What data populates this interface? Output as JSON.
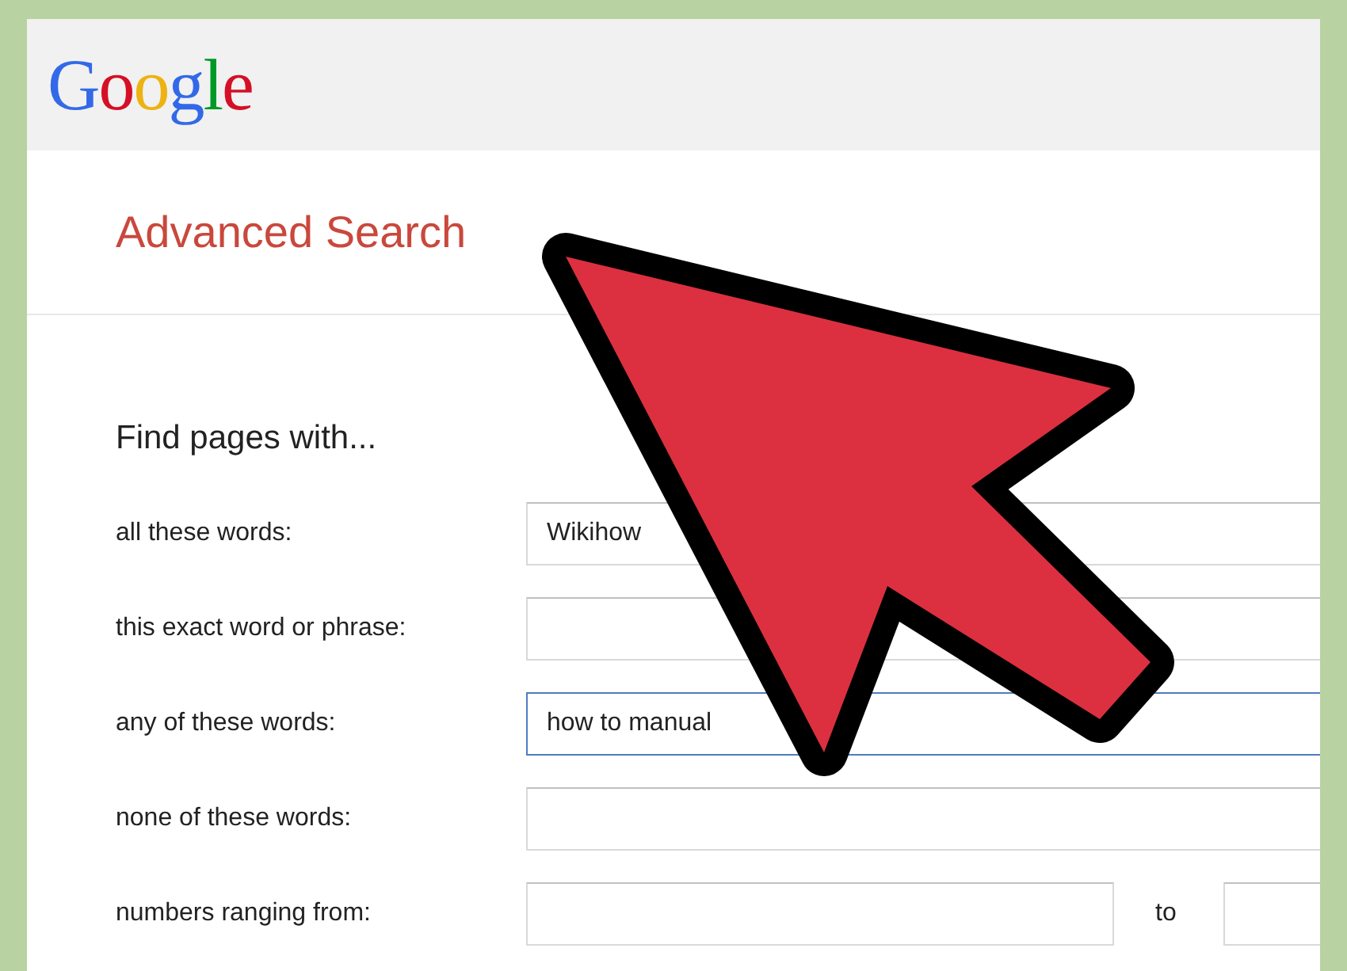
{
  "header": {
    "logo": "Google"
  },
  "page_title": "Advanced Search",
  "form": {
    "heading": "Find pages with...",
    "rows": [
      {
        "kind": "text",
        "label": "all these words:",
        "value": "Wikihow",
        "focused": false
      },
      {
        "kind": "text",
        "label": "this exact word or phrase:",
        "focused": false
      },
      {
        "kind": "text",
        "label": "any of these words:",
        "value": "how to manual",
        "focused": true
      },
      {
        "kind": "text",
        "label": "none of these words:",
        "focused": false
      },
      {
        "kind": "range",
        "label": "numbers ranging from:",
        "separator": "to",
        "focused": false
      }
    ]
  }
}
